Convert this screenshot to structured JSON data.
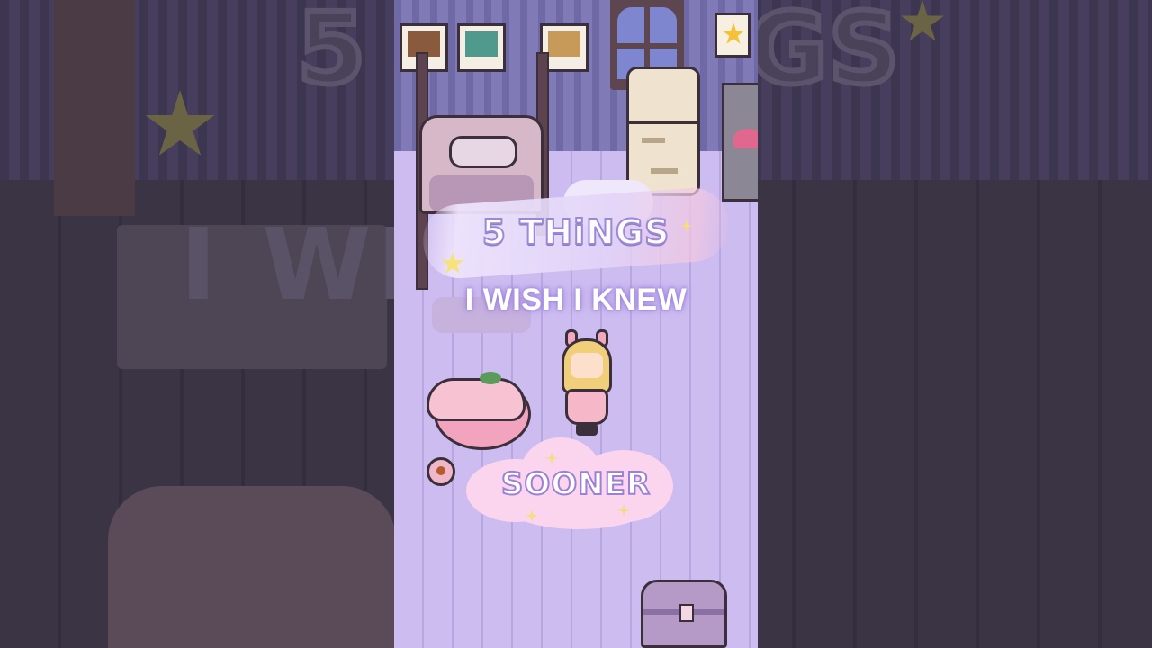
{
  "video": {
    "title_line1": "5 THiNGS",
    "title_line2": "I WISH I KNEW",
    "title_line3": "SOONER",
    "background_ghost_text": "I WI   NEW",
    "background_ghost_top": "5",
    "background_ghost_top_right": "GS"
  },
  "colors": {
    "wall": "#7a74b0",
    "floor": "#cdbcf0",
    "title_accent": "#9a8ad6",
    "cloud": "#fbd4ee",
    "outline": "#3b2f3c"
  },
  "scene": {
    "objects": [
      "wall-frame-icon",
      "wall-frame-icon",
      "wall-frame-icon",
      "window-icon",
      "fridge-icon",
      "stove-icon",
      "star-note-icon",
      "bed-icon",
      "pet-bed-icon",
      "pet-icon",
      "food-bowl-icon",
      "player-character",
      "chest-icon",
      "cloud-rug-icon"
    ]
  }
}
